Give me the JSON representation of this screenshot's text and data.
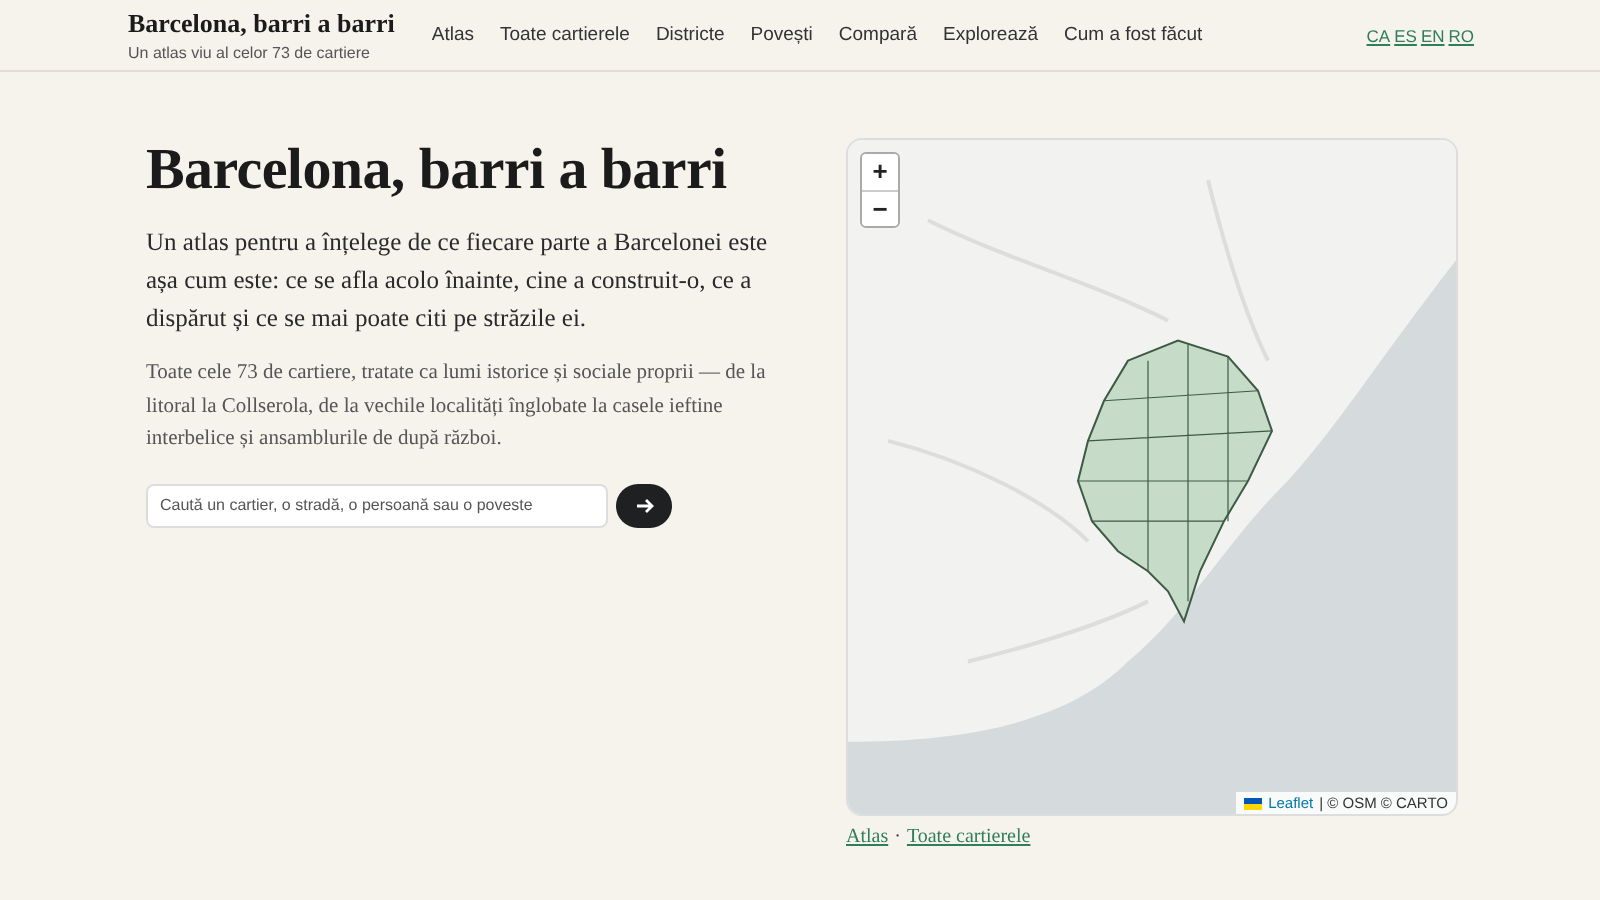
{
  "header": {
    "title": "Barcelona, barri a barri",
    "subtitle": "Un atlas viu al celor 73 de cartiere",
    "nav": [
      "Atlas",
      "Toate cartierele",
      "Districte",
      "Povești",
      "Compară",
      "Explorează",
      "Cum a fost făcut"
    ],
    "languages": [
      "CA",
      "ES",
      "EN",
      "RO"
    ]
  },
  "hero": {
    "title": "Barcelona, barri a barri",
    "lead": "Un atlas pentru a înțelege de ce fiecare parte a Barcelonei este așa cum este: ce se afla acolo înainte, cine a construit-o, ce a dispărut și ce se mai poate citi pe străzile ei.",
    "body": "Toate cele 73 de cartiere, tratate ca lumi istorice și sociale proprii — de la litoral la Collserola, de la vechile localități înglobate la casele ieftine interbelice și ansamblurile de după război.",
    "search": {
      "placeholder": "Caută un cartier, o stradă, o persoană sau o poveste"
    }
  },
  "map": {
    "zoom_in": "+",
    "zoom_out": "−",
    "attribution_link": "Leaflet",
    "attribution": "| © OSM © CARTO",
    "breadcrumbs": [
      {
        "label": "Atlas",
        "separator": "·"
      },
      {
        "label": "Toate cartierele"
      }
    ]
  }
}
